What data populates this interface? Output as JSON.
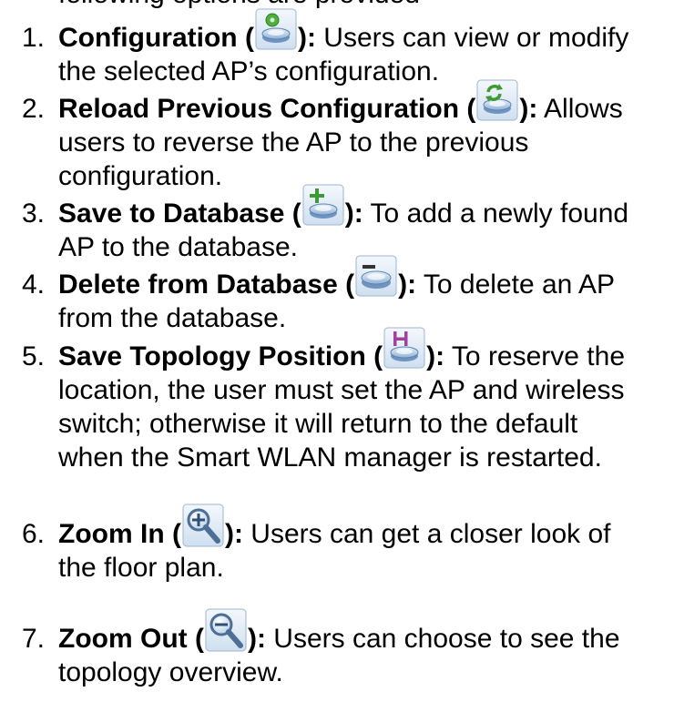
{
  "top_fragment": "following options are provided",
  "items": [
    {
      "number": "1.",
      "title": "Configuration (",
      "close": "):",
      "line1_rest": " Users can view or modify",
      "line2": "the selected AP’s configuration.",
      "icon": "configuration-icon"
    },
    {
      "number": "2.",
      "title": "Reload Previous Configuration (",
      "close": "):",
      "line1_rest": " Allows",
      "line2": "users to reverse the AP to the previous",
      "line3": "configuration.",
      "icon": "reload-configuration-icon"
    },
    {
      "number": "3.",
      "title": "Save to Database (",
      "close": "):",
      "line1_rest": " To add a newly found",
      "line2": "AP to the database.",
      "icon": "save-to-database-icon"
    },
    {
      "number": "4.",
      "title": "Delete from Database (",
      "close": "):",
      "line1_rest": " To delete an AP",
      "line2": "from the database.",
      "icon": "delete-from-database-icon"
    },
    {
      "number": "5.",
      "title": "Save Topology Position (",
      "close": "):",
      "line1_rest": " To reserve the",
      "line2": "location, the user must set the AP and wireless",
      "line3": "switch; otherwise it will return to the default",
      "line4": "when the Smart WLAN manager is restarted.",
      "icon": "save-topology-position-icon"
    },
    {
      "number": "6.",
      "title": "Zoom In (",
      "close": "):",
      "line1_rest": " Users can get a closer look of",
      "line2": "the floor plan.",
      "icon": "zoom-in-icon"
    },
    {
      "number": "7.",
      "title": "Zoom Out (",
      "close": "):",
      "line1_rest": " Users can choose to see the",
      "line2": "topology overview.",
      "icon": "zoom-out-icon"
    }
  ]
}
